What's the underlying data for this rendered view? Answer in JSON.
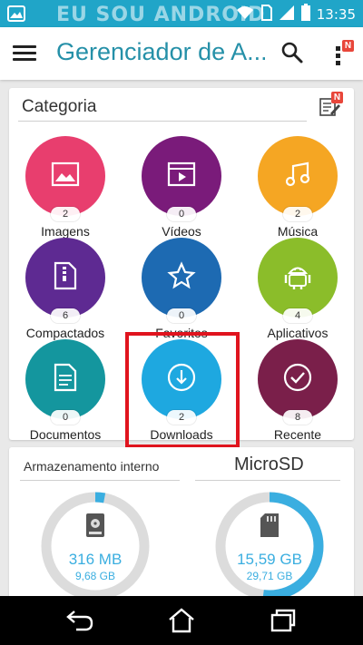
{
  "status_bar": {
    "time": "13:35",
    "watermark": "EU SOU ANDROID",
    "icons": [
      "image-notification-icon",
      "wifi-icon",
      "sim-icon",
      "signal-icon",
      "battery-icon"
    ]
  },
  "app_bar": {
    "title": "Gerenciador de A...",
    "badge": "N"
  },
  "category": {
    "header": "Categoria",
    "edit_badge": "N",
    "tiles": [
      {
        "label": "Imagens",
        "count": "2",
        "color": "#e83e6e",
        "icon": "image-icon"
      },
      {
        "label": "Vídeos",
        "count": "0",
        "color": "#7a1b7a",
        "icon": "video-icon"
      },
      {
        "label": "Música",
        "count": "2",
        "color": "#f5a623",
        "icon": "music-icon"
      },
      {
        "label": "Compactados",
        "count": "6",
        "color": "#5e2a92",
        "icon": "zip-icon"
      },
      {
        "label": "Favoritos",
        "count": "0",
        "color": "#1d6ab2",
        "icon": "star-icon"
      },
      {
        "label": "Aplicativos",
        "count": "4",
        "color": "#8bbd2a",
        "icon": "android-icon"
      },
      {
        "label": "Documentos",
        "count": "0",
        "color": "#14969e",
        "icon": "document-icon"
      },
      {
        "label": "Downloads",
        "count": "2",
        "color": "#1ea8e0",
        "icon": "download-icon"
      },
      {
        "label": "Recente",
        "count": "8",
        "color": "#7a1f4a",
        "icon": "check-icon"
      }
    ]
  },
  "storage": {
    "internal": {
      "label": "Armazenamento interno",
      "used": "316 MB",
      "total": "9,68 GB",
      "used_fraction": 0.03
    },
    "sd": {
      "label": "MicroSD",
      "used": "15,59 GB",
      "total": "29,71 GB",
      "used_fraction": 0.52
    }
  },
  "colors": {
    "accent": "#20a5c8",
    "ring_track": "#dcdcdc",
    "ring_fill": "#3aaee0",
    "highlight": "#e0141e"
  }
}
